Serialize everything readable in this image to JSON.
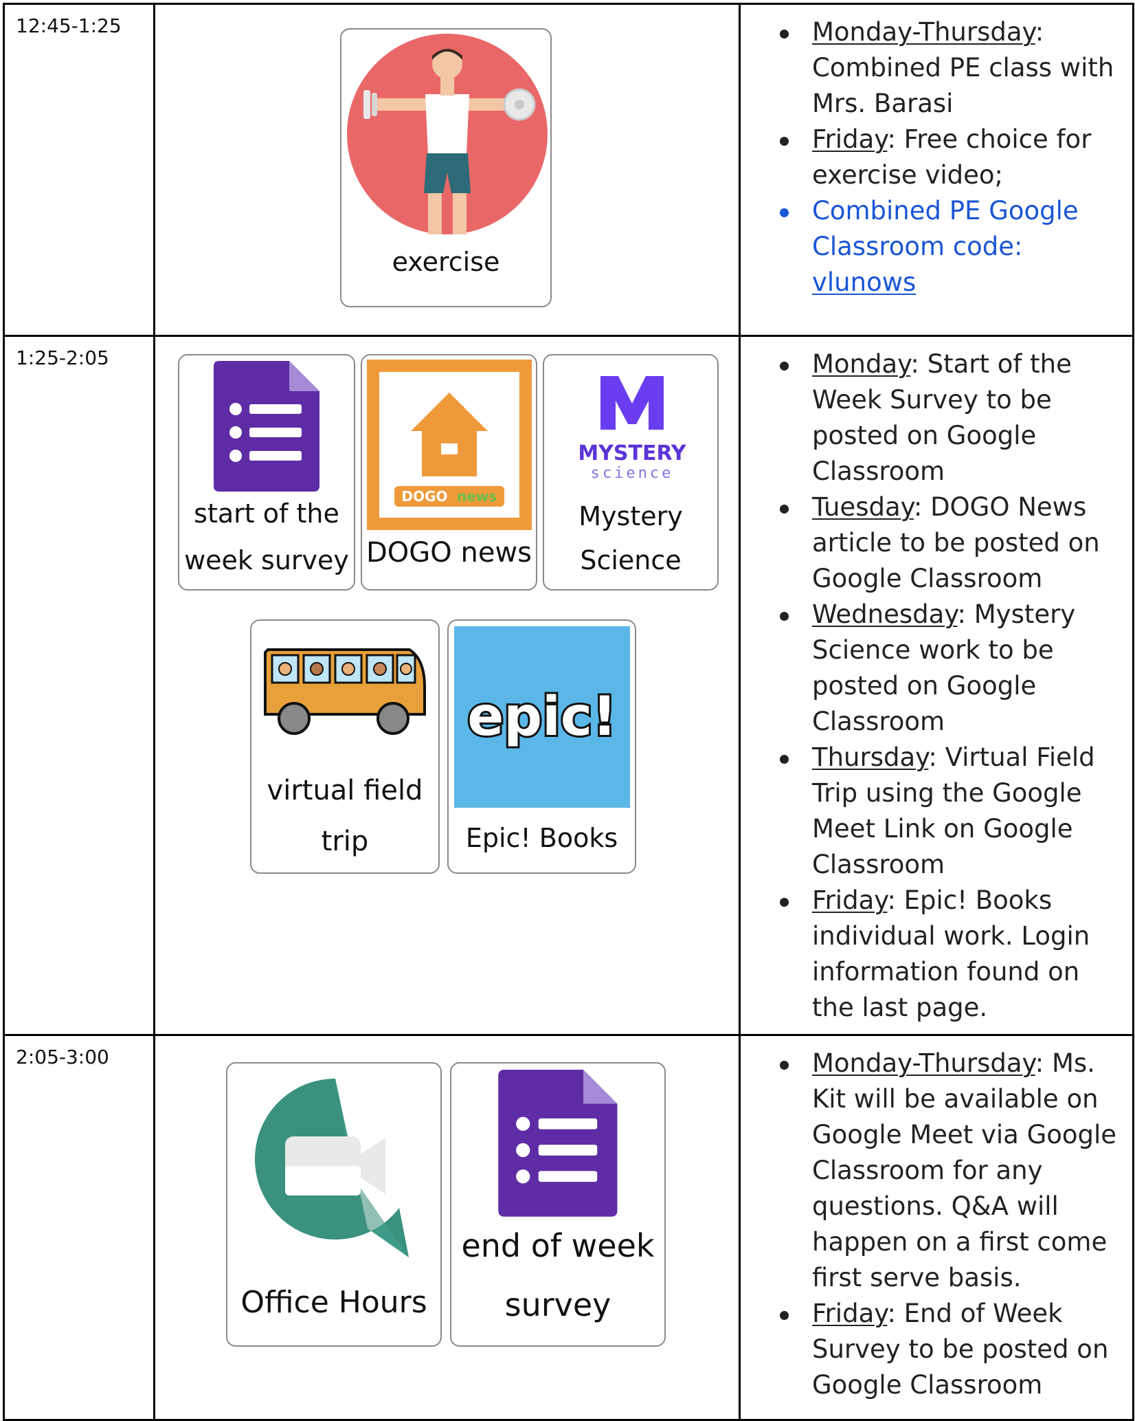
{
  "rows": [
    {
      "time": "12:45-1:25",
      "cards": [
        {
          "label": "exercise"
        }
      ],
      "notes": [
        {
          "day": "Monday-Thursday",
          "text": ": Combined PE class with Mrs. Barasi"
        },
        {
          "day": "Friday",
          "text": ": Free choice for exercise video;"
        },
        {
          "prefix": "Combined PE Google Classroom code: ",
          "link": "vlunows"
        }
      ]
    },
    {
      "time": "1:25-2:05",
      "cards": [
        {
          "label_line1": "start of the",
          "label_line2": "week survey"
        },
        {
          "label": "DOGO news",
          "logo_text_a": "DOGO",
          "logo_text_b": "news"
        },
        {
          "label_line1": "Mystery",
          "label_line2": "Science",
          "logo_word1": "MYSTERY",
          "logo_word2": "science"
        },
        {
          "label_line1": "virtual field",
          "label_line2": "trip"
        },
        {
          "label": "Epic! Books",
          "logo_text": "epic!"
        }
      ],
      "notes": [
        {
          "day": "Monday",
          "text": ": Start of the Week Survey to be posted on Google Classroom"
        },
        {
          "day": "Tuesday",
          "text": ": DOGO News article to be posted on Google Classroom"
        },
        {
          "day": "Wednesday",
          "text": ": Mystery Science work to be posted on Google Classroom"
        },
        {
          "day": "Thursday",
          "text": ": Virtual Field Trip using the Google Meet Link on Google Classroom"
        },
        {
          "day": "Friday",
          "text": ": Epic! Books individual work. Login information found on the last page."
        }
      ]
    },
    {
      "time": "2:05-3:00",
      "cards": [
        {
          "label": "Office Hours"
        },
        {
          "label_line1": "end of week",
          "label_line2": "survey"
        }
      ],
      "notes": [
        {
          "day": "Monday-Thursday",
          "text": ": Ms. Kit will be available on Google Meet via Google Classroom for any questions. Q&A will happen on a first come first serve basis."
        },
        {
          "day": "Friday",
          "text": ": End of Week Survey to be posted on Google Classroom"
        }
      ]
    }
  ],
  "colors": {
    "link_blue": "#1a55d6",
    "forms_purple": "#5e2ca5",
    "dogo_orange": "#ef9a3a",
    "mystery_purple": "#6a3df0",
    "epic_blue": "#5bb7e8",
    "meet_green": "#3f9a87",
    "exercise_red": "#ea6768"
  },
  "icons": [
    "exercise-icon",
    "google-forms-icon",
    "dogo-news-icon",
    "mystery-science-icon",
    "bus-icon",
    "epic-books-icon",
    "google-meet-icon"
  ]
}
